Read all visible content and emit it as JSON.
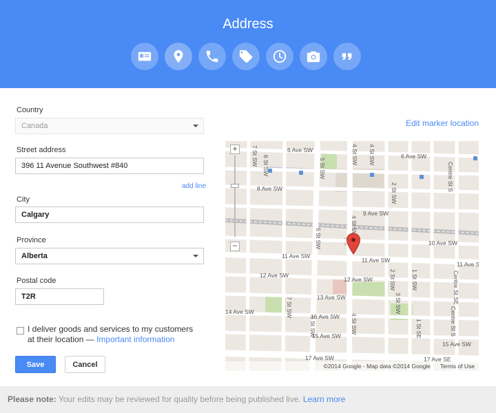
{
  "header": {
    "title": "Address",
    "icons": [
      "contact-card-icon",
      "location-pin-icon",
      "phone-icon",
      "tag-icon",
      "clock-icon",
      "camera-icon",
      "quote-icon"
    ]
  },
  "form": {
    "country_label": "Country",
    "country_value": "Canada",
    "street_label": "Street address",
    "street_value": "396 11 Avenue Southwest #840",
    "add_line": "add line",
    "city_label": "City",
    "city_value": "Calgary",
    "province_label": "Province",
    "province_value": "Alberta",
    "postal_label": "Postal code",
    "postal_value": "T2R",
    "checkbox_text": "I deliver goods and services to my customers at their location — ",
    "checkbox_link": "Important information",
    "save_label": "Save",
    "cancel_label": "Cancel"
  },
  "map": {
    "edit_marker": "Edit marker location",
    "attribution": "©2014 Google - Map data ©2014 Google",
    "terms": "Terms of Use",
    "zoom_in": "+",
    "zoom_out": "−",
    "streets": {
      "ave6a": "6 Ave SW",
      "ave6b": "6 Ave SW",
      "ave8": "8 Ave SW",
      "ave9": "9 Ave SW",
      "ave10": "10 Ave SW",
      "ave11a": "11 Ave SW",
      "ave11b": "11 Ave SW",
      "ave11c": "11 Ave SW",
      "ave12a": "12 Ave SW",
      "ave12b": "12 Ave SW",
      "ave13": "13 Ave SW",
      "ave14": "14 Ave SW",
      "ave15a": "15 Ave SW",
      "ave15b": "15 Ave SW",
      "ave16": "16 Ave SW",
      "ave17a": "17 Ave SW",
      "ave17b": "17 Ave SE",
      "st7": "7 St SW",
      "st7b": "7 St SW",
      "st6": "6 St SW",
      "st5": "5 St SW",
      "st5b": "5 St SW",
      "st5c": "5 St SW",
      "st4": "4 St SW",
      "st4b": "4 St SW",
      "st4c": "4 St SW",
      "st4d": "4 St SW",
      "st2": "2 St SW",
      "st2b": "2 St SW",
      "st1": "1 St SW",
      "st1b": "1 St SE",
      "centre": "Centre St S",
      "centre2": "Centre St SE",
      "st3": "3 St SW"
    }
  },
  "footer": {
    "note_label": "Please note:",
    "note_text": " Your edits may be reviewed for quality before being published live. ",
    "learn_more": "Learn more"
  },
  "colors": {
    "header_bg": "#4a8af4",
    "accent": "#4a8af4",
    "map_bg": "#ece8e1",
    "park": "#c9dfaf",
    "pin": "#e2433b"
  }
}
